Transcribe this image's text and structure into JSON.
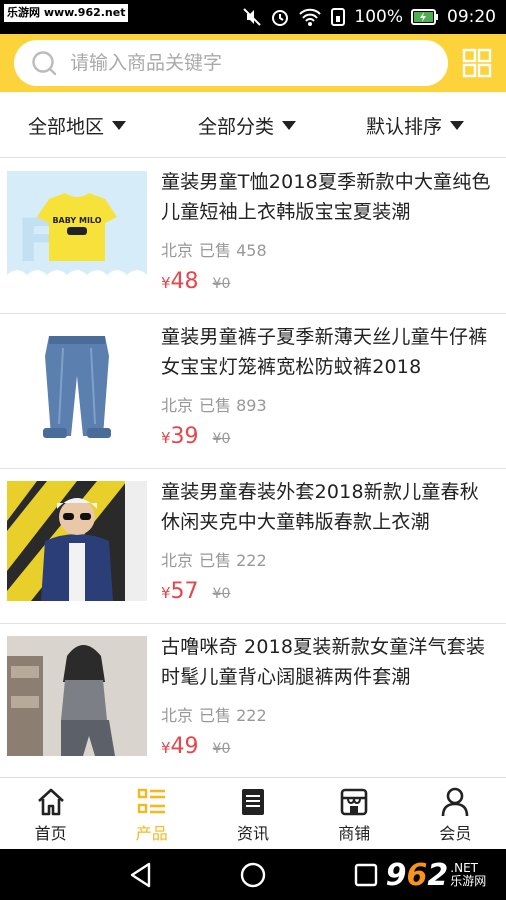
{
  "status_bar": {
    "watermark": "乐游网 www.962.net",
    "battery": "100%",
    "time": "09:20"
  },
  "search": {
    "placeholder": "请输入商品关键字"
  },
  "filters": [
    {
      "label": "全部地区"
    },
    {
      "label": "全部分类"
    },
    {
      "label": "默认排序"
    }
  ],
  "products": [
    {
      "title": "童装男童T恤2018夏季新款中大童纯色儿童短袖上衣韩版宝宝夏装潮",
      "location": "北京",
      "sold": "已售 458",
      "currency": "¥",
      "price": "48",
      "original_price": "¥0",
      "image_text": "BABY MILO"
    },
    {
      "title": "童装男童裤子夏季新薄天丝儿童牛仔裤女宝宝灯笼裤宽松防蚊裤2018",
      "location": "北京",
      "sold": "已售 893",
      "currency": "¥",
      "price": "39",
      "original_price": "¥0"
    },
    {
      "title": "童装男童春装外套2018新款儿童春秋休闲夹克中大童韩版春款上衣潮",
      "location": "北京",
      "sold": "已售 222",
      "currency": "¥",
      "price": "57",
      "original_price": "¥0"
    },
    {
      "title": "古噜咪奇 2018夏装新款女童洋气套装时髦儿童背心阔腿裤两件套潮",
      "location": "北京",
      "sold": "已售 222",
      "currency": "¥",
      "price": "49",
      "original_price": "¥0"
    }
  ],
  "tabs": [
    {
      "label": "首页",
      "icon": "home-icon"
    },
    {
      "label": "产品",
      "icon": "list-icon",
      "active": true
    },
    {
      "label": "资讯",
      "icon": "news-icon"
    },
    {
      "label": "商铺",
      "icon": "shop-icon"
    },
    {
      "label": "会员",
      "icon": "user-icon"
    }
  ],
  "brand_watermark": {
    "number_a": "9",
    "number_b": "6",
    "number_c": "2",
    "net": ".NET",
    "name": "乐游网"
  },
  "colors": {
    "accent": "#fcd33b",
    "active_tab": "#f5b81d",
    "price": "#e8454a"
  }
}
